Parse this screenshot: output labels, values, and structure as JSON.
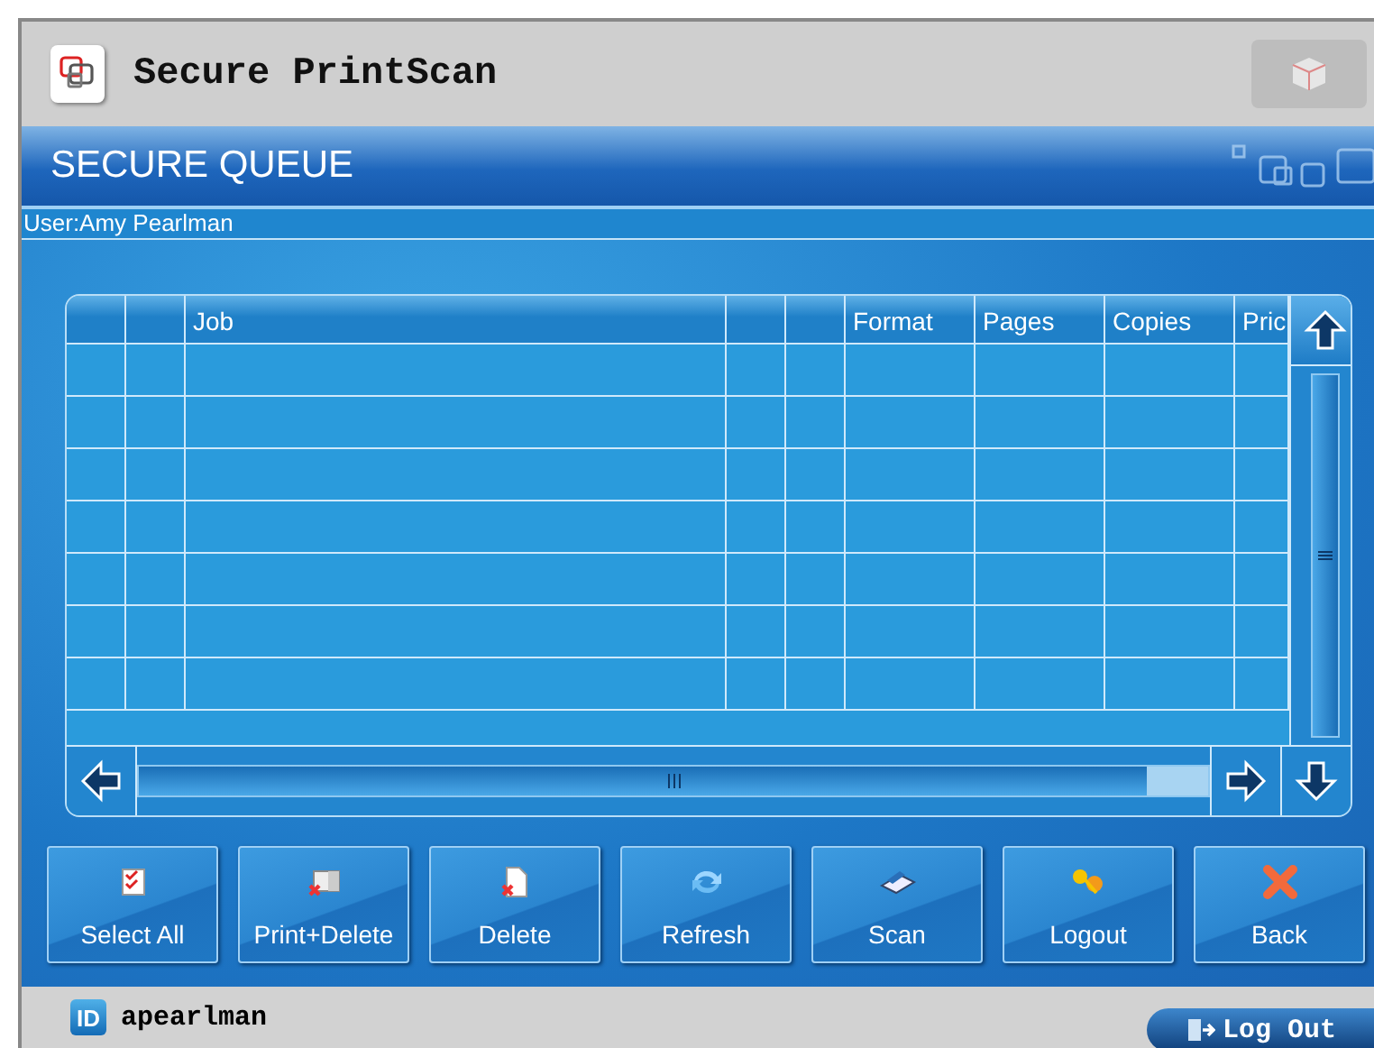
{
  "app": {
    "title": "Secure PrintScan"
  },
  "title_bar": {
    "title": "SECURE QUEUE"
  },
  "user_bar": {
    "text": "User:Amy Pearlman"
  },
  "table": {
    "columns": [
      {
        "kind": "blank"
      },
      {
        "kind": "blank"
      },
      {
        "kind": "text",
        "label": "Job"
      },
      {
        "kind": "blank"
      },
      {
        "kind": "blank"
      },
      {
        "kind": "text",
        "label": "Format"
      },
      {
        "kind": "text",
        "label": "Pages"
      },
      {
        "kind": "text",
        "label": "Copies"
      },
      {
        "kind": "text",
        "label": "Pric"
      }
    ]
  },
  "buttons": [
    {
      "kind": "select",
      "label": "Select All"
    },
    {
      "kind": "printdelete",
      "label": "Print+Delete"
    },
    {
      "kind": "delete",
      "label": "Delete"
    },
    {
      "kind": "refresh",
      "label": "Refresh"
    },
    {
      "kind": "scan",
      "label": "Scan"
    },
    {
      "kind": "logout",
      "label": "Logout"
    },
    {
      "kind": "back",
      "label": "Back"
    }
  ],
  "footer": {
    "badge": "ID",
    "user": "apearlman",
    "logout": "Log Out"
  }
}
